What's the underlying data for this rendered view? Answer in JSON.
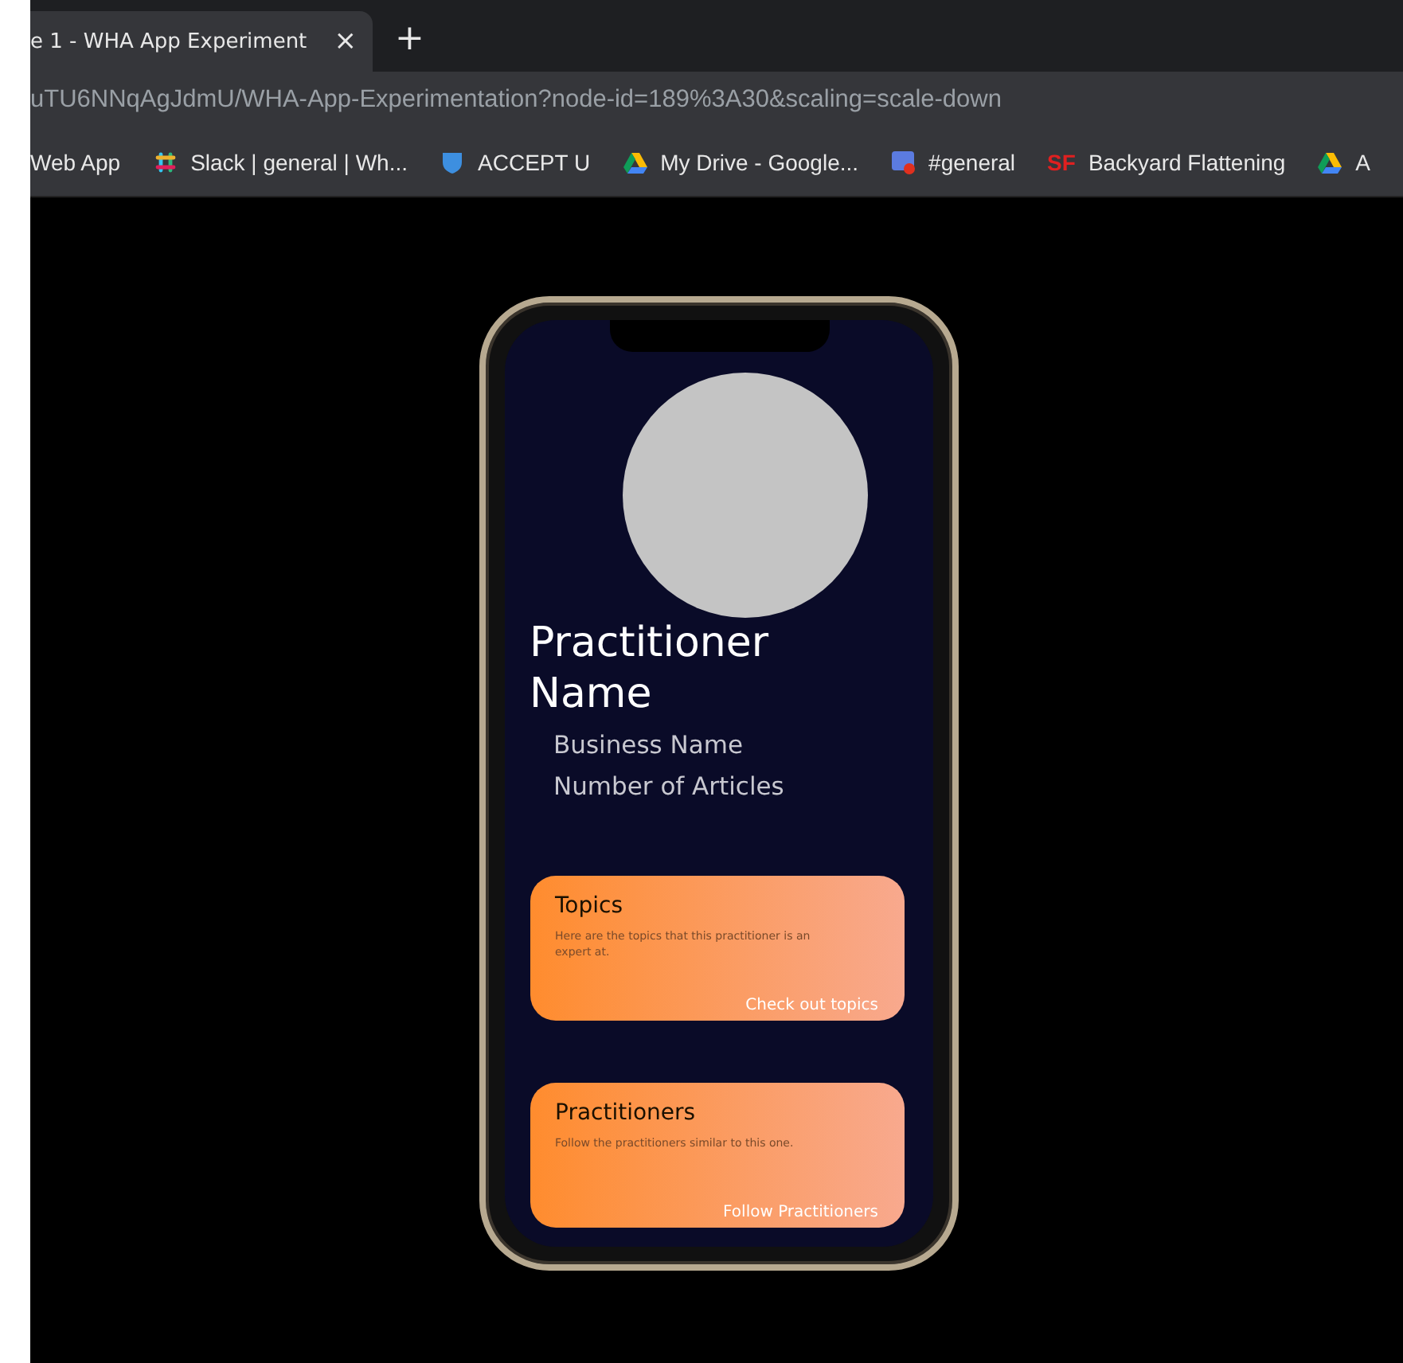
{
  "browser": {
    "tab": {
      "title": "e 1 - WHA App Experiment",
      "close": "×"
    },
    "new_tab": "+",
    "address": "uTU6NNqAgJdmU/WHA-App-Experimentation?node-id=189%3A30&scaling=scale-down",
    "bookmarks": [
      {
        "label": "Web App",
        "kind": "none"
      },
      {
        "label": "Slack | general | Wh...",
        "kind": "slack"
      },
      {
        "label": "ACCEPT U",
        "kind": "shield"
      },
      {
        "label": "My Drive - Google...",
        "kind": "drive"
      },
      {
        "label": "#general",
        "kind": "chat"
      },
      {
        "label": "Backyard Flattening",
        "kind": "sf",
        "badge": "SF"
      },
      {
        "label": "A",
        "kind": "drive"
      }
    ]
  },
  "profile": {
    "name": "Practitioner Name",
    "business": "Business Name",
    "articles": "Number of Articles"
  },
  "cards": [
    {
      "title": "Topics",
      "text": "Here are the topics that this practitioner is an expert at.",
      "action": "Check out topics"
    },
    {
      "title": "Practitioners",
      "text": "Follow the practitioners similar to this one.",
      "action": "Follow Practitioners"
    }
  ]
}
